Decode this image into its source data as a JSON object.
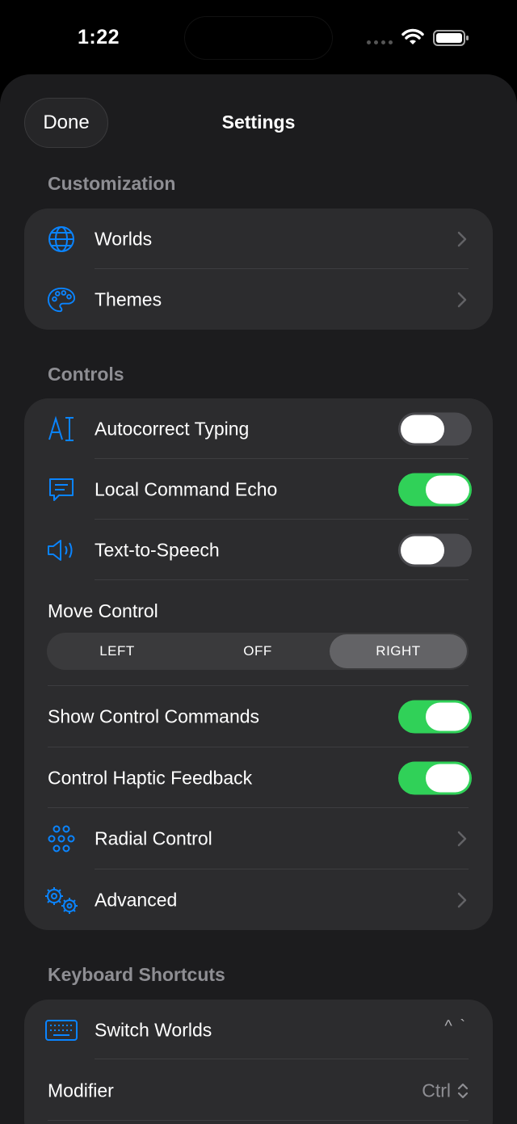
{
  "status_bar": {
    "time": "1:22"
  },
  "nav": {
    "done_label": "Done",
    "title": "Settings"
  },
  "sections": {
    "customization": "Customization",
    "controls": "Controls",
    "keyboard_shortcuts": "Keyboard Shortcuts"
  },
  "customization_rows": [
    {
      "label": "Worlds",
      "icon": "globe-icon"
    },
    {
      "label": "Themes",
      "icon": "palette-icon"
    }
  ],
  "controls_rows": {
    "autocorrect": {
      "label": "Autocorrect Typing",
      "icon": "text-cursor-icon",
      "enabled": false
    },
    "local_echo": {
      "label": "Local Command Echo",
      "icon": "message-icon",
      "enabled": true
    },
    "tts": {
      "label": "Text-to-Speech",
      "icon": "speaker-icon",
      "enabled": false
    },
    "move_control": {
      "label": "Move Control",
      "options": [
        "LEFT",
        "OFF",
        "RIGHT"
      ],
      "selected": "RIGHT"
    },
    "show_commands": {
      "label": "Show Control Commands",
      "enabled": true
    },
    "haptic": {
      "label": "Control Haptic Feedback",
      "enabled": true
    },
    "radial": {
      "label": "Radial Control",
      "icon": "radial-icon"
    },
    "advanced": {
      "label": "Advanced",
      "icon": "gears-icon"
    }
  },
  "keyboard_rows": {
    "switch_worlds": {
      "label": "Switch Worlds",
      "icon": "keyboard-icon",
      "indicator": "^ `"
    },
    "modifier": {
      "label": "Modifier",
      "value": "Ctrl"
    }
  },
  "colors": {
    "accent": "#0a84ff",
    "toggle_on": "#30d158",
    "background": "#1c1c1e",
    "card": "#2c2c2e"
  }
}
